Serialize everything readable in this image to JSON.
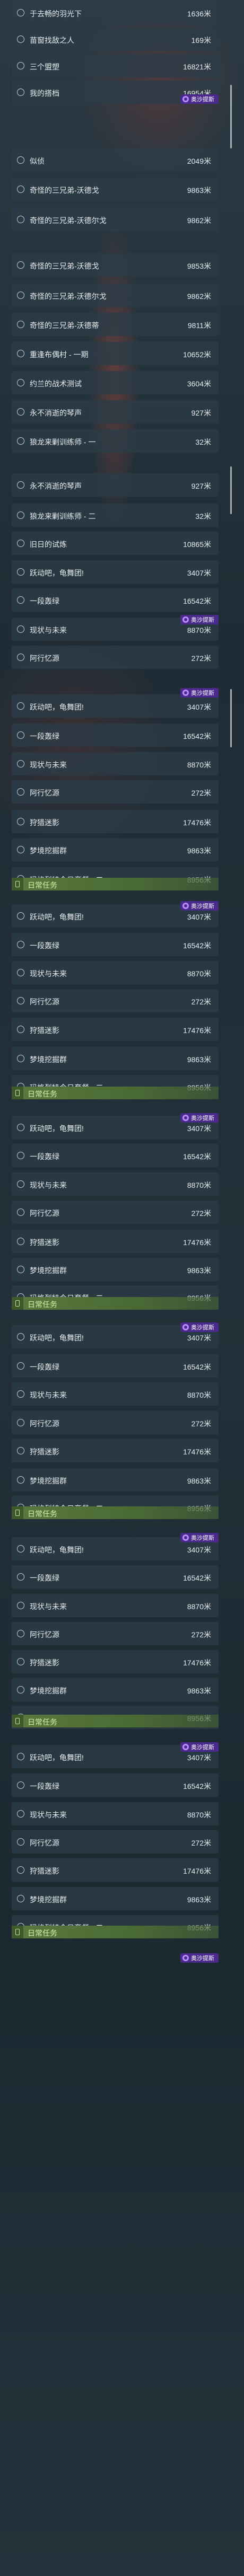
{
  "colors": {
    "badge_bg": "#4a2a8a",
    "banner_bg": "#5a7a40",
    "row_bg": "#2c3c48",
    "text": "#e8ecef"
  },
  "badge": {
    "icon": "ring-icon",
    "text": "奥沙提斯"
  },
  "banner": {
    "icon": "task-icon",
    "title": "日常任务"
  },
  "rows": [
    {
      "label": "于去畅的羽光下",
      "value": "1636米"
    },
    {
      "label": "苗窗找敌之人",
      "value": "169米"
    },
    {
      "label": "三个盟塑",
      "value": "16821米"
    },
    {
      "label": "我的搭档",
      "value": "16954米"
    },
    {
      "label": "似侦",
      "value": "2049米"
    },
    {
      "label": "奇怪的三兄弟-沃德戈",
      "value": "9863米"
    },
    {
      "label": "奇怪的三兄弟-沃德尔戈",
      "value": "9862米"
    },
    {
      "label": "奇怪的三兄弟-沃德戈",
      "value": "9853米"
    },
    {
      "label": "奇怪的三兄弟-沃德尔戈",
      "value": "9862米"
    },
    {
      "label": "奇怪的三兄弟-沃德蒂",
      "value": "9811米"
    },
    {
      "label": "重逢布偶村 - 一期",
      "value": "10652米"
    },
    {
      "label": "约兰的战术测试",
      "value": "3604米"
    },
    {
      "label": "永不消逝的琴声",
      "value": "927米"
    },
    {
      "label": "狼龙来剿训练师 - 一",
      "value": "32米"
    },
    {
      "label": "永不消逝的琴声",
      "value": "927米"
    },
    {
      "label": "狼龙来剿训练师 - 二",
      "value": "32米"
    },
    {
      "label": "旧日的试炼",
      "value": "10865米"
    },
    {
      "label": "跃动吧，龟舞团!",
      "value": "3407米"
    },
    {
      "label": "一段轰绿",
      "value": "16542米"
    },
    {
      "label": "现状与未来",
      "value": "8870米"
    },
    {
      "label": "阿行忆源",
      "value": "272米"
    },
    {
      "label": "跃动吧，龟舞团!",
      "value": "3407米"
    },
    {
      "label": "一段轰绿",
      "value": "16542米"
    },
    {
      "label": "现状与未来",
      "value": "8870米"
    },
    {
      "label": "阿行忆源",
      "value": "272米"
    },
    {
      "label": "狩猎迷影",
      "value": "17476米"
    },
    {
      "label": "梦境挖掘群",
      "value": "9863米"
    },
    {
      "label": "玛格烈特今日套餐 - 二",
      "value": "8956米"
    },
    {
      "label": "跃动吧，龟舞团!",
      "value": "3407米"
    },
    {
      "label": "一段轰绿",
      "value": "16542米"
    },
    {
      "label": "现状与未来",
      "value": "8870米"
    },
    {
      "label": "阿行忆源",
      "value": "272米"
    },
    {
      "label": "狩猎迷影",
      "value": "17476米"
    },
    {
      "label": "梦境挖掘群",
      "value": "9863米"
    },
    {
      "label": "玛格烈特今日套餐 - 二",
      "value": "8956米"
    },
    {
      "label": "跃动吧，龟舞团!",
      "value": "3407米"
    },
    {
      "label": "一段轰绿",
      "value": "16542米"
    },
    {
      "label": "现状与未来",
      "value": "8870米"
    },
    {
      "label": "阿行忆源",
      "value": "272米"
    },
    {
      "label": "狩猎迷影",
      "value": "17476米"
    },
    {
      "label": "梦境挖掘群",
      "value": "9863米"
    },
    {
      "label": "玛格烈特今日套餐 - 二",
      "value": "8956米"
    },
    {
      "label": "跃动吧，龟舞团!",
      "value": "3407米"
    },
    {
      "label": "一段轰绿",
      "value": "16542米"
    },
    {
      "label": "现状与未来",
      "value": "8870米"
    },
    {
      "label": "阿行忆源",
      "value": "272米"
    },
    {
      "label": "狩猎迷影",
      "value": "17476米"
    },
    {
      "label": "梦境挖掘群",
      "value": "9863米"
    },
    {
      "label": "玛格烈特今日套餐 - 二",
      "value": "8956米"
    },
    {
      "label": "跃动吧，龟舞团!",
      "value": "3407米"
    },
    {
      "label": "一段轰绿",
      "value": "16542米"
    },
    {
      "label": "现状与未来",
      "value": "8870米"
    },
    {
      "label": "阿行忆源",
      "value": "272米"
    },
    {
      "label": "狩猎迷影",
      "value": "17476米"
    },
    {
      "label": "梦境挖掘群",
      "value": "9863米"
    },
    {
      "label": "玛格烈特今日套餐 - 二",
      "value": "8956米"
    },
    {
      "label": "跃动吧，龟舞团!",
      "value": "3407米"
    },
    {
      "label": "一段轰绿",
      "value": "16542米"
    },
    {
      "label": "现状与未来",
      "value": "8870米"
    },
    {
      "label": "阿行忆源",
      "value": "272米"
    },
    {
      "label": "狩猎迷影",
      "value": "17476米"
    },
    {
      "label": "梦境挖掘群",
      "value": "9863米"
    },
    {
      "label": "玛格烈特今日套餐 - 二",
      "value": "8956米"
    }
  ]
}
